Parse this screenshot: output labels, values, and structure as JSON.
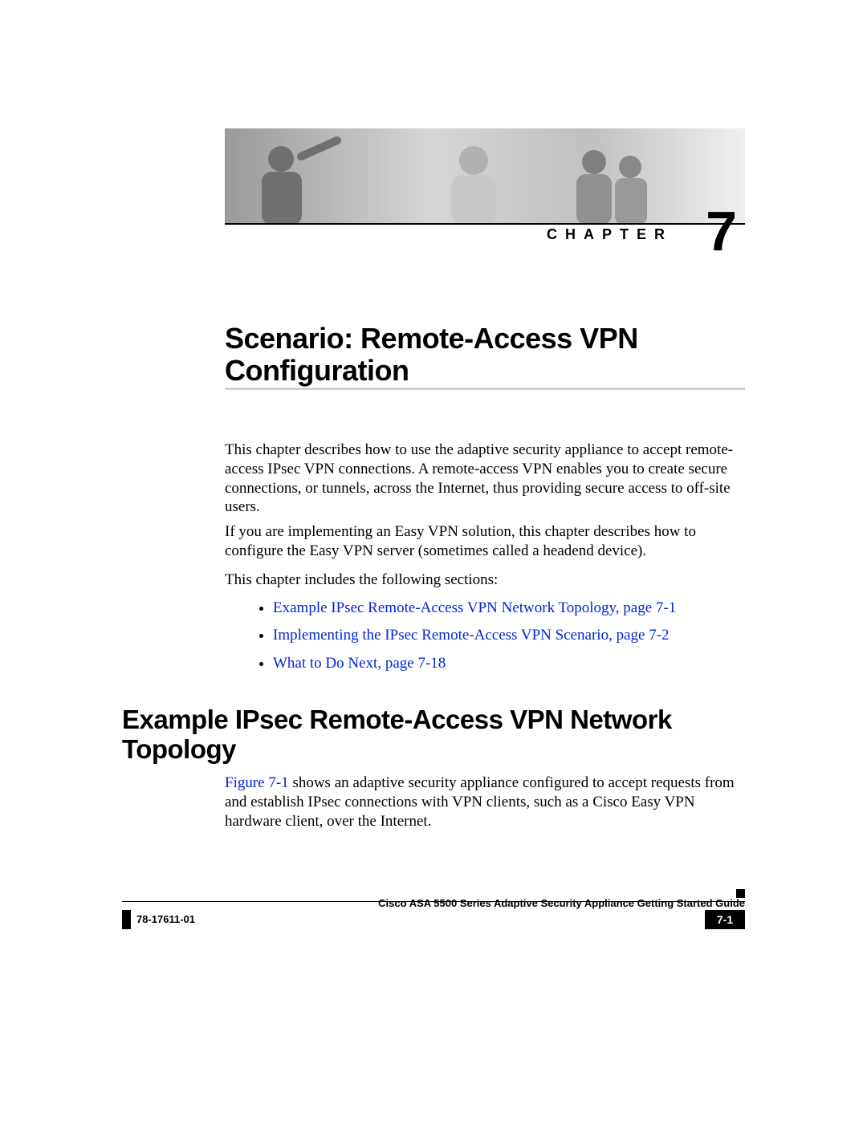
{
  "chapter": {
    "label": "CHAPTER",
    "number": "7"
  },
  "title": "Scenario: Remote-Access VPN Configuration",
  "paragraphs": {
    "intro1": "This chapter describes how to use the adaptive security appliance to accept remote-access IPsec VPN connections. A remote-access VPN enables you to create secure connections, or tunnels, across the Internet, thus providing secure access to off-site users.",
    "intro2": "If you are implementing an Easy VPN solution, this chapter describes how to configure the Easy VPN server (sometimes called a headend device).",
    "intro3": "This chapter includes the following sections:",
    "section_intro_pre": "Figure 7-1",
    "section_intro_post": " shows an adaptive security appliance configured to accept requests from and establish IPsec connections with VPN clients, such as a Cisco Easy VPN hardware client, over the Internet."
  },
  "links": {
    "b1": "Example IPsec Remote-Access VPN Network Topology, page 7-1",
    "b2": "Implementing the IPsec Remote-Access VPN Scenario, page 7-2",
    "b3": "What to Do Next, page 7-18"
  },
  "section_heading": "Example IPsec Remote-Access VPN Network Topology",
  "footer": {
    "guide": "Cisco ASA 5500 Series Adaptive Security Appliance Getting Started Guide",
    "docnum": "78-17611-01",
    "pagenum": "7-1"
  }
}
